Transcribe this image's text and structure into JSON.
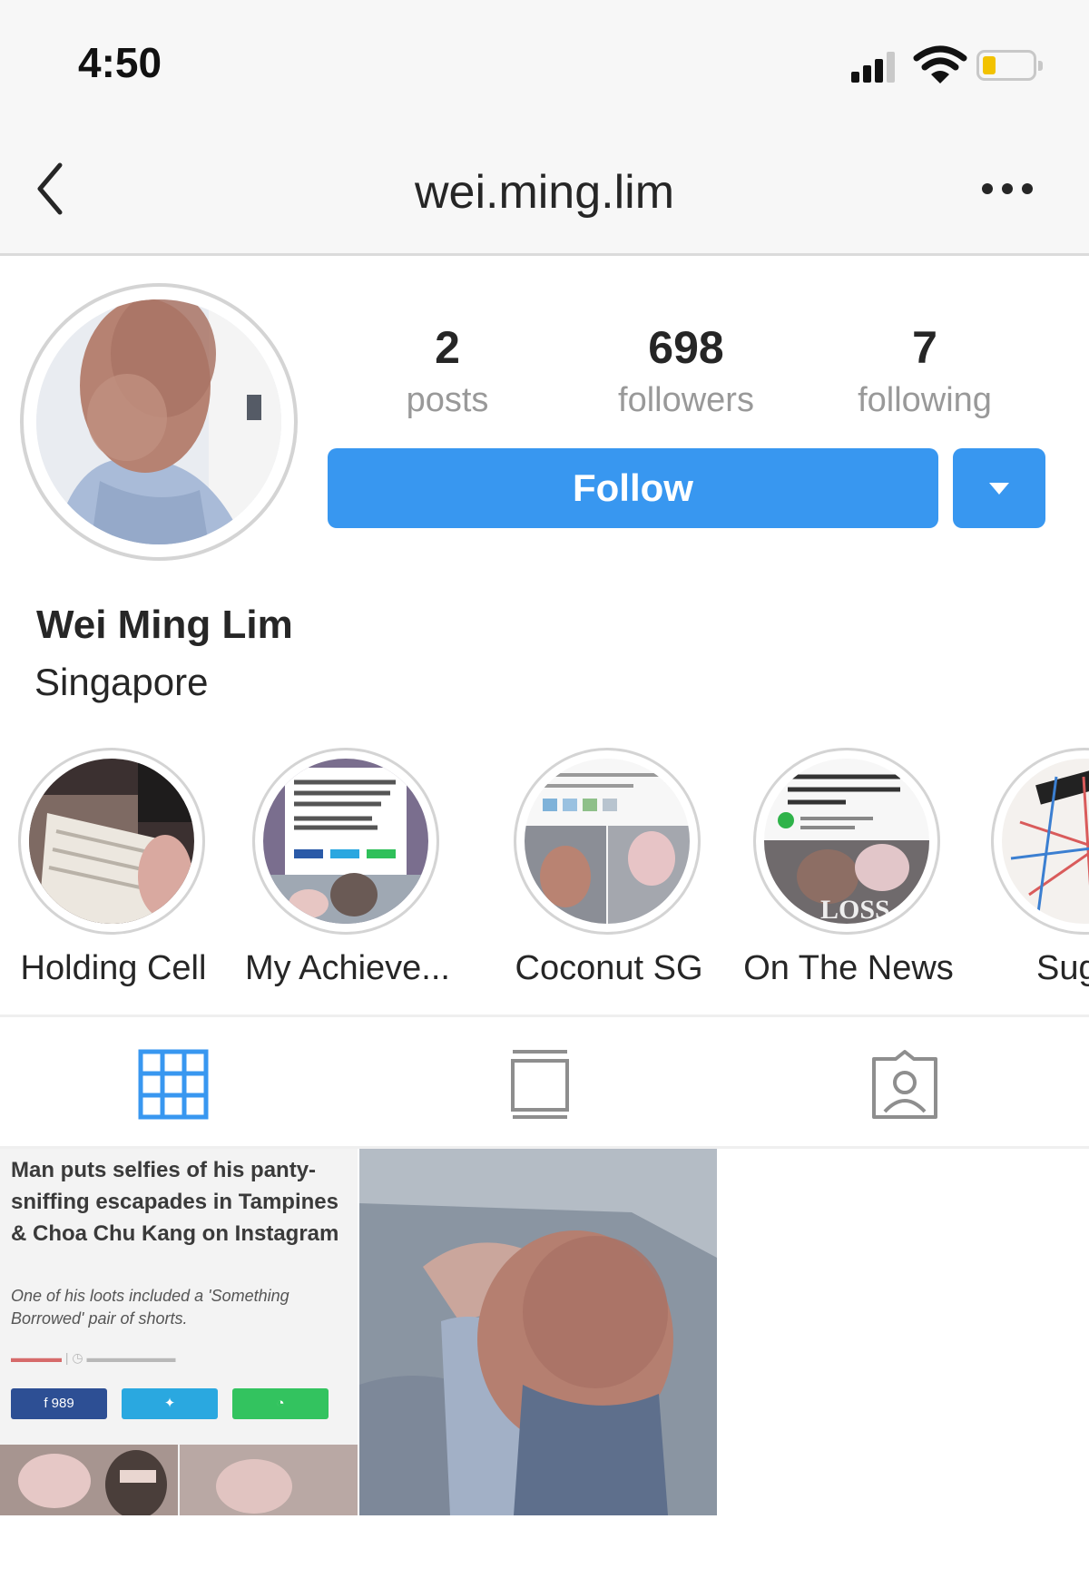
{
  "status_bar": {
    "time": "4:50"
  },
  "nav": {
    "username": "wei.ming.lim"
  },
  "stats": [
    {
      "value": "2",
      "label": "posts"
    },
    {
      "value": "698",
      "label": "followers"
    },
    {
      "value": "7",
      "label": "following"
    }
  ],
  "actions": {
    "follow_label": "Follow"
  },
  "profile": {
    "full_name": "Wei Ming Lim",
    "bio": "Singapore"
  },
  "highlights": [
    {
      "label": "Holding Cell"
    },
    {
      "label": "My Achieve..."
    },
    {
      "label": "Coconut SG"
    },
    {
      "label": "On The News"
    },
    {
      "label": "Sugge"
    }
  ],
  "tabs": [
    {
      "icon": "grid-icon",
      "active": true
    },
    {
      "icon": "feed-icon",
      "active": false
    },
    {
      "icon": "tagged-icon",
      "active": false
    }
  ],
  "posts": [
    {
      "type": "article",
      "headline": "Man puts selfies of his panty-sniffing escapades in Tampines & Choa Chu Kang on Instagram",
      "subhead": "One of his loots included a 'Something Borrowed' pair of shorts.",
      "share_count": "989"
    },
    {
      "type": "photo"
    }
  ],
  "colors": {
    "accent": "#3897f0",
    "muted": "#999999",
    "text": "#262626"
  }
}
